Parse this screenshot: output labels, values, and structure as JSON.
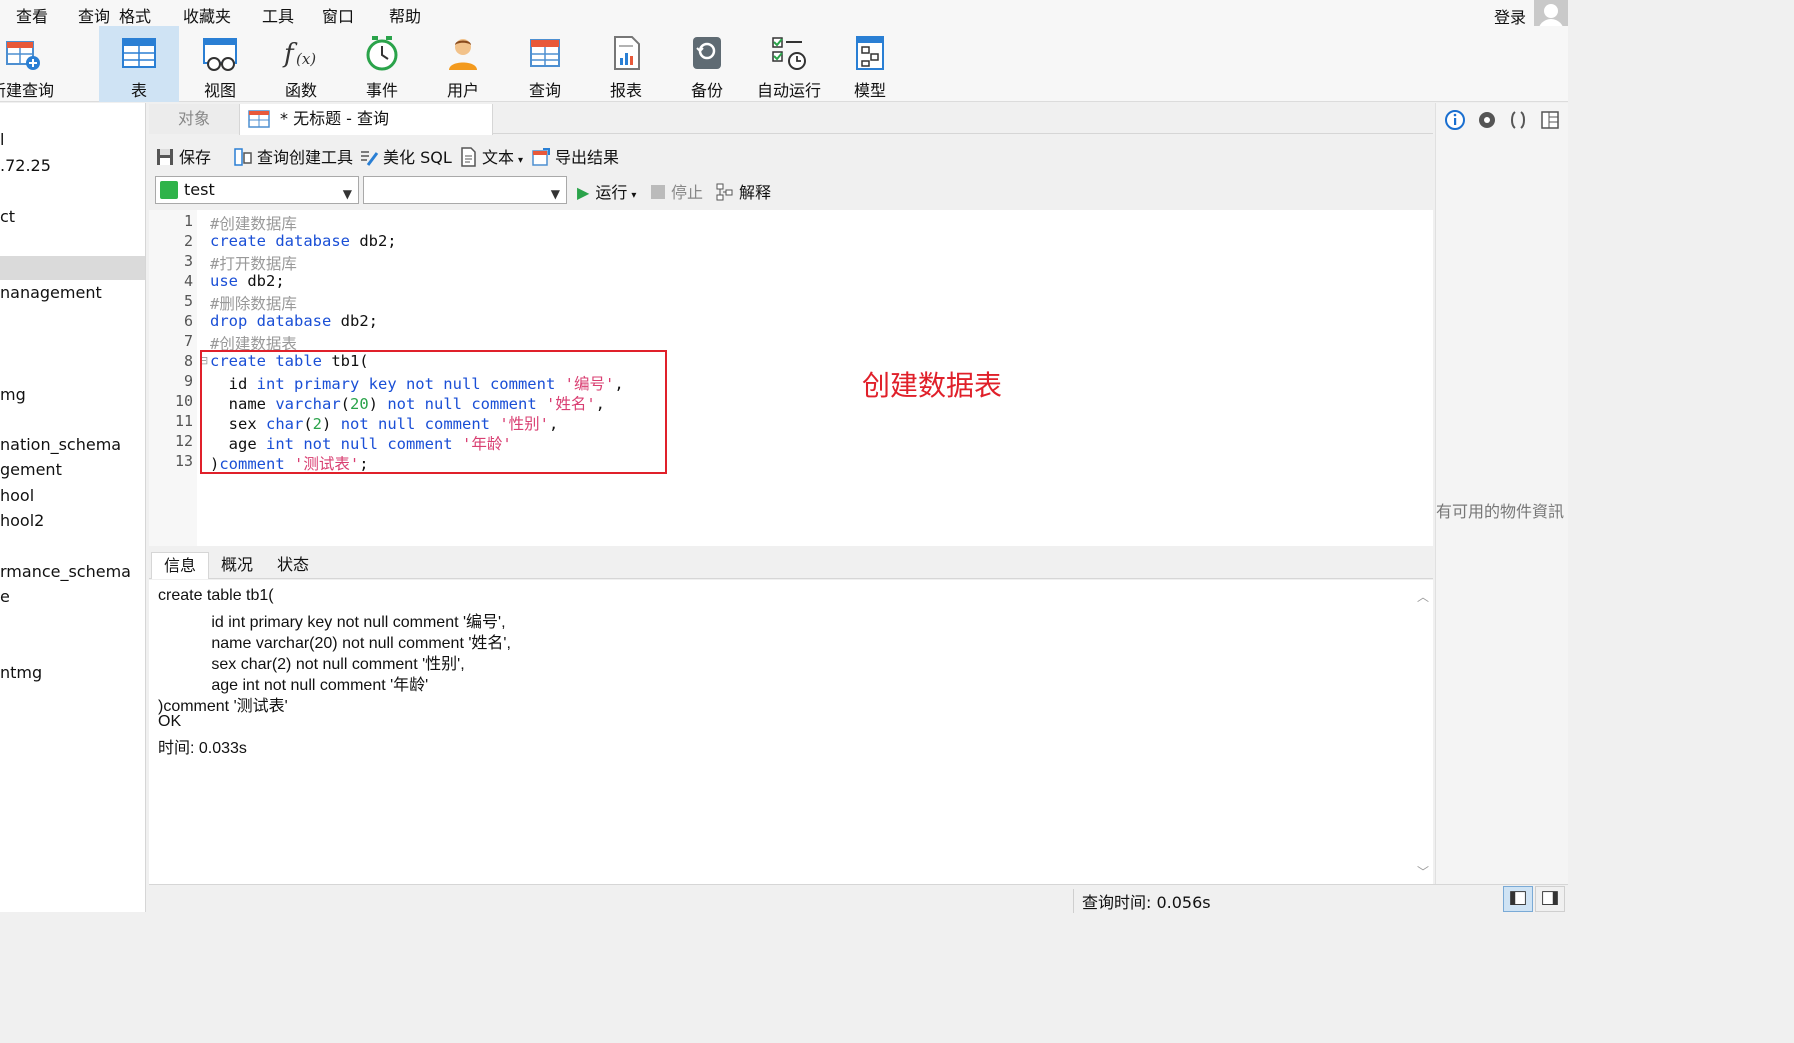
{
  "menu": {
    "items": [
      "查看",
      "查询",
      "格式",
      "收藏夹",
      "工具",
      "窗口",
      "帮助"
    ],
    "login": "登录"
  },
  "ribbon": {
    "buttons": [
      {
        "label": "新建查询",
        "icon": "new-query-icon"
      },
      {
        "label": "表",
        "icon": "table-icon",
        "active": true
      },
      {
        "label": "视图",
        "icon": "view-icon"
      },
      {
        "label": "函数",
        "icon": "function-icon"
      },
      {
        "label": "事件",
        "icon": "event-clock-icon"
      },
      {
        "label": "用户",
        "icon": "user-icon"
      },
      {
        "label": "查询",
        "icon": "query-icon"
      },
      {
        "label": "报表",
        "icon": "report-icon"
      },
      {
        "label": "备份",
        "icon": "backup-icon"
      },
      {
        "label": "自动运行",
        "icon": "auto-run-icon"
      },
      {
        "label": "模型",
        "icon": "model-icon"
      }
    ]
  },
  "sidebar": {
    "items": [
      "l",
      ".72.25",
      "ct",
      "nanagement",
      "mg",
      "nation_schema",
      "gement",
      "hool",
      "hool2",
      "rmance_schema",
      "e",
      "ntmg"
    ]
  },
  "tabs": {
    "objects": "对象",
    "query": "* 无标题 - 查询"
  },
  "editor_toolbar": {
    "save": "保存",
    "query_builder": "查询创建工具",
    "beautify": "美化 SQL",
    "text": "文本",
    "export": "导出结果"
  },
  "selectors": {
    "database": "test",
    "schema": "",
    "run": "运行",
    "stop": "停止",
    "explain": "解释"
  },
  "code": {
    "line_numbers": [
      "1",
      "2",
      "3",
      "4",
      "5",
      "6",
      "7",
      "8",
      "9",
      "10",
      "11",
      "12",
      "13"
    ]
  },
  "annotation": "创建数据表",
  "result": {
    "tabs": [
      "信息",
      "概况",
      "状态"
    ],
    "lines": [
      "create table tb1(",
      "            id int primary key not null comment '编号',",
      "            name varchar(20) not null comment '姓名',",
      "            sex char(2) not null comment '性别',",
      "            age int not null comment '年龄'",
      ")comment '测试表'",
      "OK",
      "时间: 0.033s"
    ]
  },
  "right_panel": {
    "message": "有可用的物件資訊"
  },
  "status": {
    "query_time": "查询时间: 0.056s"
  },
  "colors": {
    "keyword": "#1a4fd6",
    "comment": "#999999",
    "string": "#d93f72",
    "number": "#2aa34a",
    "annotation": "#e0202a",
    "active_ribbon": "#cfe3f4"
  }
}
